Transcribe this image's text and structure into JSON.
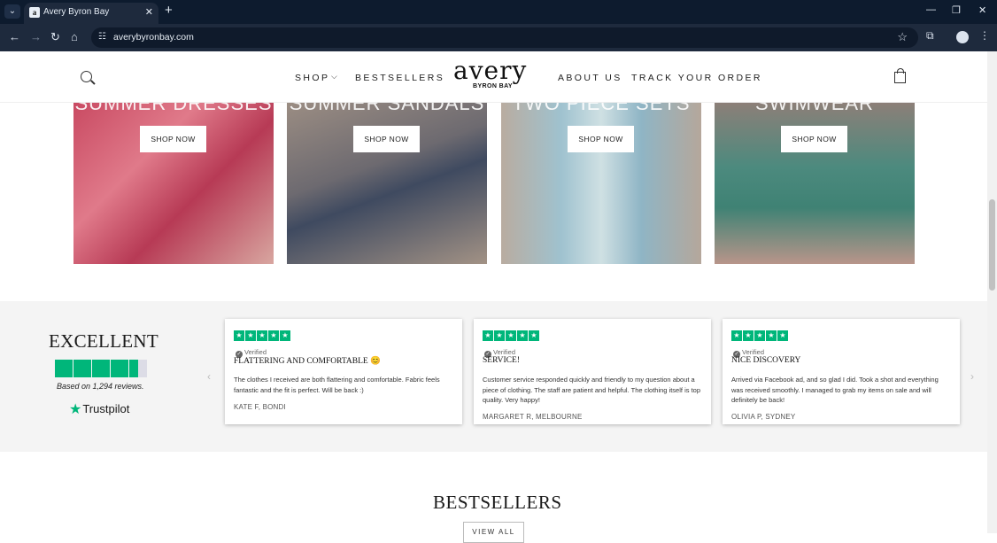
{
  "browser": {
    "tab_title": "Avery Byron Bay",
    "tab_favicon_letter": "a",
    "url": "averybyronbay.com",
    "new_tab": "+",
    "close_tab": "✕",
    "menu_glyph": "⌄",
    "window_minimize": "—",
    "window_restore": "❐",
    "window_close": "✕",
    "icons": [
      "back-icon",
      "forward-icon",
      "reload-icon",
      "home-icon",
      "site-info-icon",
      "star-icon",
      "extensions-icon",
      "profile-icon",
      "menu-icon"
    ]
  },
  "header": {
    "nav": {
      "shop": "SHOP",
      "bestsellers": "BESTSELLERS",
      "about": "ABOUT US",
      "track": "TRACK YOUR ORDER"
    },
    "logo": "avery",
    "logo_sub": "BYRON BAY"
  },
  "categories": [
    {
      "title": "SUMMER DRESSES",
      "button": "SHOP NOW"
    },
    {
      "title": "SUMMER SANDALS",
      "button": "SHOP NOW"
    },
    {
      "title": "TWO PIECE SETS",
      "button": "SHOP NOW"
    },
    {
      "title": "SWIMWEAR",
      "button": "SHOP NOW"
    }
  ],
  "trustpilot": {
    "rating_word": "EXCELLENT",
    "based_on": "Based on 1,294 reviews.",
    "brand": "Trustpilot",
    "stars": 4.5
  },
  "reviews": [
    {
      "verified": "Verified",
      "title": "FLATTERING AND COMFORTABLE 😊",
      "body": "The clothes I received are both flattering and comfortable. Fabric feels fantastic and the fit is perfect. Will be back :)",
      "author": "KATE F, BONDI"
    },
    {
      "verified": "Verified",
      "title": "SERVICE!",
      "body": "Customer service responded quickly and friendly to my question about a piece of clothing. The staff are patient and helpful. The clothing itself is top quality. Very happy!",
      "author": "MARGARET R, MELBOURNE"
    },
    {
      "verified": "Verified",
      "title": "NICE DISCOVERY",
      "body": "Arrived via Facebook ad, and so glad I did. Took a shot and everything was received smoothly. I managed to grab my items on sale and will definitely be back!",
      "author": "OLIVIA P, SYDNEY"
    }
  ],
  "bestsellers": {
    "title": "BESTSELLERS",
    "view_all": "VIEW ALL"
  },
  "colors": {
    "trustpilot_green": "#00b67a",
    "browser_dark": "#0d1b2e"
  }
}
